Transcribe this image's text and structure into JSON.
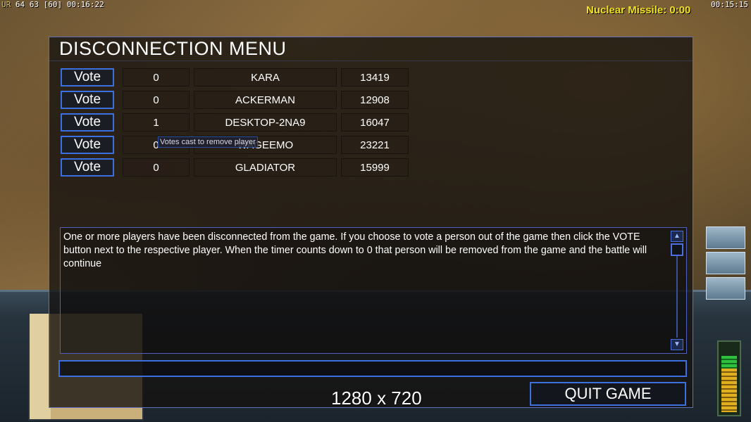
{
  "hud": {
    "stats_prefix": "UR",
    "stats_values": "64 63 [60]",
    "left_timer": "00:16:22",
    "right_timer": "00:15:15",
    "nuclear_missile": "Nuclear Missile: 0:00"
  },
  "dialog": {
    "title": "DISCONNECTION MENU",
    "players": [
      {
        "vote_label": "Vote",
        "votes": "0",
        "name": "KARA",
        "ping": "13419"
      },
      {
        "vote_label": "Vote",
        "votes": "0",
        "name": "ACKERMAN",
        "ping": "12908"
      },
      {
        "vote_label": "Vote",
        "votes": "1",
        "name": "DESKTOP-2NA9",
        "ping": "16047"
      },
      {
        "vote_label": "Vote",
        "votes": "0",
        "name": "WAGEEMO",
        "ping": "23221"
      },
      {
        "vote_label": "Vote",
        "votes": "0",
        "name": "GLADIATOR",
        "ping": "15999"
      }
    ],
    "tooltip": "Votes cast to remove player",
    "message": "One or more players have been disconnected from the game. If you choose to vote a person out of the game then click the VOTE button next to the respective player. When the timer counts down to 0 that person will be removed from the game and the battle will continue",
    "chat_value": "",
    "quit_label": "QUIT GAME",
    "resolution_overlay": "1280 x 720"
  },
  "colors": {
    "accent_blue": "#3c70e0",
    "nuke_text": "#f0e020",
    "panel_bg": "#141210"
  },
  "icons": {
    "scroll_up": "scroll-up-arrow-icon",
    "scroll_down": "scroll-down-arrow-icon"
  }
}
